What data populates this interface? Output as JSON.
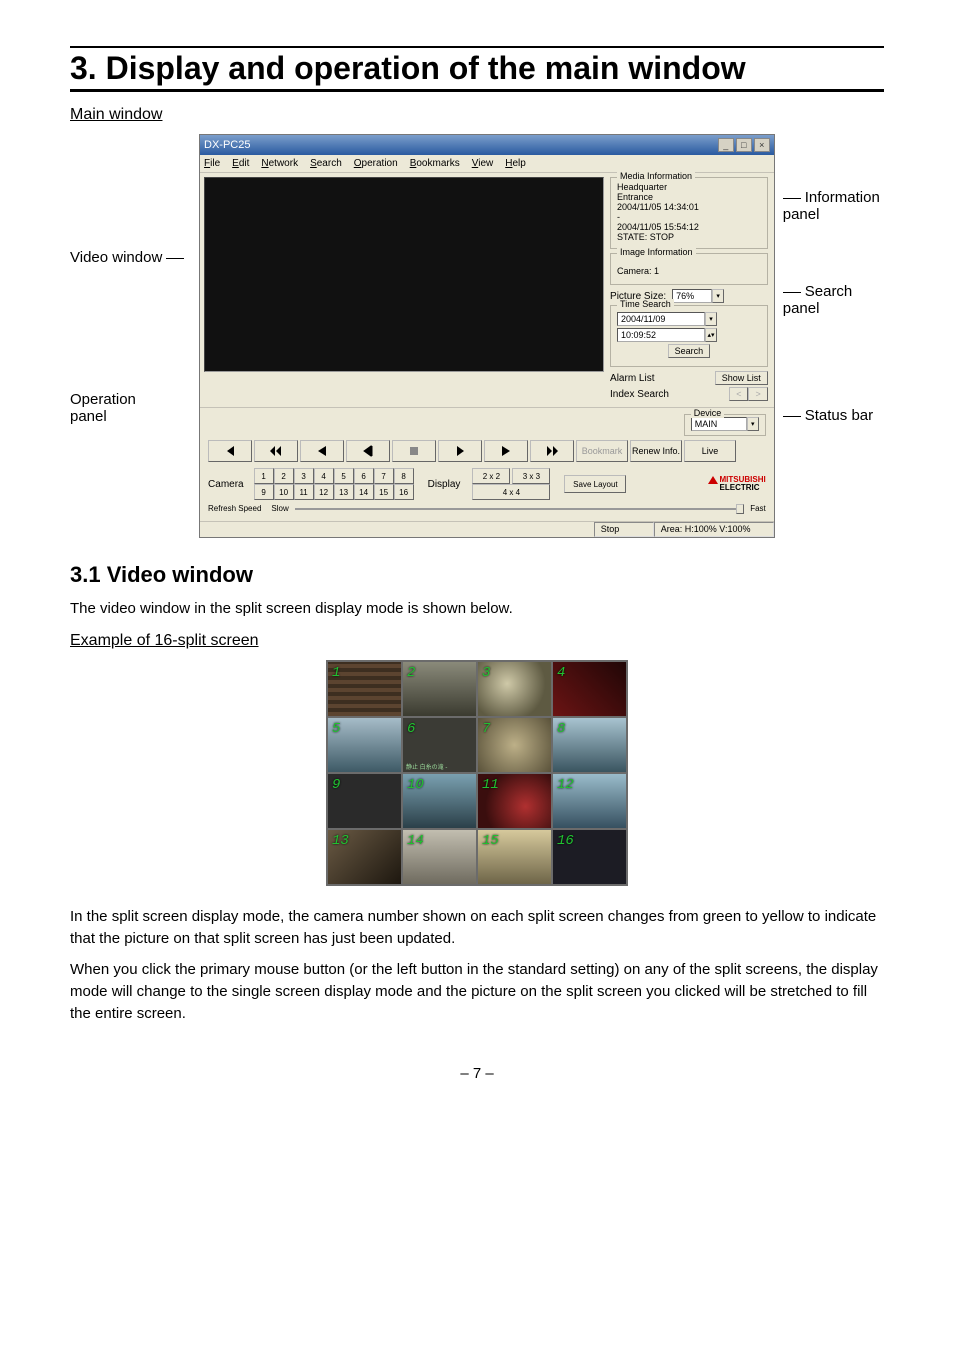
{
  "chapter_title": "3. Display and operation of the main window",
  "main_window_label": "Main window",
  "labels": {
    "video_window": "Video window",
    "operation_panel": "Operation\npanel",
    "info_panel": "Information\npanel",
    "search_panel": "Search\npanel",
    "status_bar": "Status bar"
  },
  "app": {
    "title": "DX-PC25",
    "menus": [
      "File",
      "Edit",
      "Network",
      "Search",
      "Operation",
      "Bookmarks",
      "View",
      "Help"
    ],
    "media_info": {
      "legend": "Media Information",
      "l1": "Headquarter",
      "l2": "Entrance",
      "l3": "2004/11/05 14:34:01",
      "l4": "-",
      "l5": "2004/11/05 15:54:12",
      "l6": "STATE: STOP"
    },
    "image_info": {
      "legend": "Image Information",
      "camera": "Camera: 1"
    },
    "picsize_label": "Picture Size:",
    "picsize_value": "76%",
    "timesearch": {
      "legend": "Time Search",
      "date": "2004/11/09",
      "time": "10:09:52",
      "search": "Search"
    },
    "alarm_label": "Alarm List",
    "showlist": "Show List",
    "index_label": "Index Search",
    "device_legend": "Device",
    "device_value": "MAIN",
    "transport": {
      "bookmark": "Bookmark",
      "renew": "Renew Info.",
      "live": "Live"
    },
    "camera_label": "Camera",
    "cam_buttons_r1": [
      "1",
      "2",
      "3",
      "4",
      "5",
      "6",
      "7",
      "8"
    ],
    "cam_buttons_r2": [
      "9",
      "10",
      "11",
      "12",
      "13",
      "14",
      "15",
      "16"
    ],
    "display_label": "Display",
    "disp": [
      "2 x 2",
      "3 x 3",
      "4 x 4"
    ],
    "save_layout": "Save Layout",
    "logo1": "MITSUBISHI",
    "logo2": "ELECTRIC",
    "refresh_label": "Refresh Speed",
    "slow": "Slow",
    "fast": "Fast",
    "status_left": "Stop",
    "status_right": "Area: H:100% V:100%"
  },
  "section_title": "3.1 Video window",
  "section_intro": "The video window in the split screen display mode is shown below.",
  "example_label": "Example of 16-split screen",
  "split_numbers": [
    "1",
    "2",
    "3",
    "4",
    "5",
    "6",
    "7",
    "8",
    "9",
    "10",
    "11",
    "12",
    "13",
    "14",
    "15",
    "16"
  ],
  "caption6": "静止 白糸の滝 -",
  "para1": "In the split screen display mode, the camera number shown on each split screen changes from green to yellow to indicate that the picture on that split screen has just been updated.",
  "para2": "When you click the primary mouse button (or the left button in the standard setting) on any of the split screens, the display mode will change to the single screen display mode and the picture on the split screen you clicked will be stretched to fill the entire screen.",
  "page_number": "– 7 –"
}
